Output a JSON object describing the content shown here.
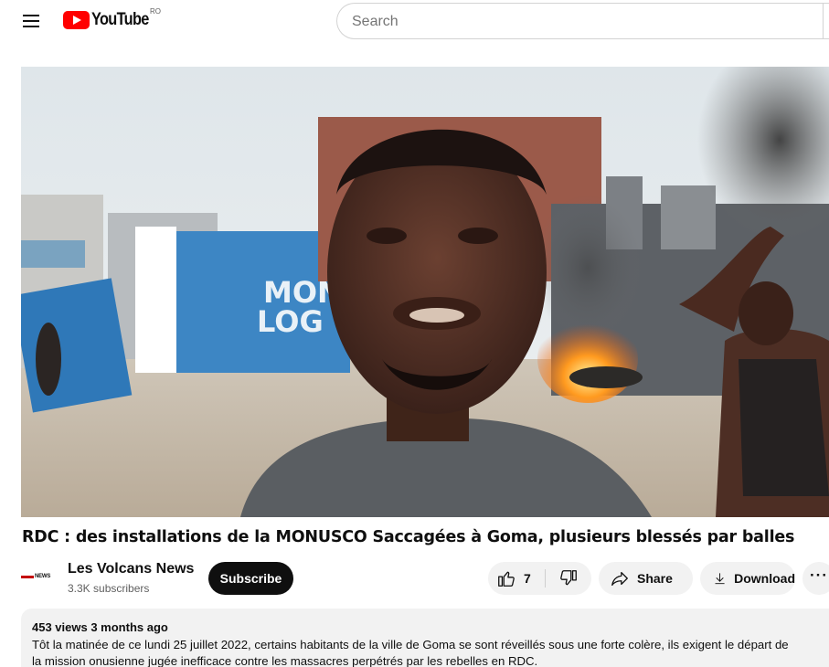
{
  "header": {
    "logo_text": "YouTube",
    "region": "RO",
    "search_placeholder": "Search"
  },
  "icons": {
    "menu": "hamburger-menu-icon",
    "logo": "youtube-logo-icon",
    "like": "thumbs-up-icon",
    "dislike": "thumbs-down-icon",
    "share": "share-arrow-icon",
    "download": "download-arrow-icon",
    "more": "more-horizontal-icon"
  },
  "video": {
    "title": "RDC : des installations de la MONUSCO Saccagées à Goma, plusieurs blessés par balles",
    "wall_sign_line1": "MON",
    "wall_sign_line2": "LOG"
  },
  "channel": {
    "avatar_text": "NEWS",
    "name": "Les Volcans News",
    "subscribers": "3.3K subscribers",
    "subscribe_label": "Subscribe"
  },
  "actions": {
    "like_count": "7",
    "share_label": "Share",
    "download_label": "Download",
    "more_label": "···"
  },
  "description": {
    "meta": "453 views  3 months ago",
    "line1": "Tôt la matinée de ce lundi 25 juillet 2022, certains habitants de la ville de Goma se sont réveillés sous une forte colère, ils exigent le départ de",
    "line2": "la mission onusienne jugée inefficace contre les massacres perpétrés par les rebelles en RDC."
  },
  "colors": {
    "brand_red": "#ff0000",
    "text_primary": "#0f0f0f",
    "text_secondary": "#606060",
    "button_bg": "#f2f2f2",
    "subscribe_bg": "#0f0f0f"
  }
}
